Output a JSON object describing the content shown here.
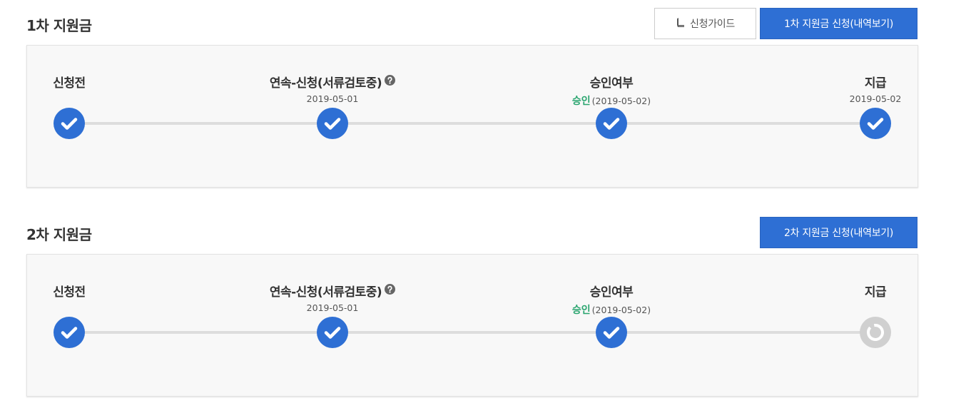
{
  "sections": [
    {
      "title": "1차 지원금",
      "guide_button": "신청가이드",
      "apply_button": "1차 지원금 신청(내역보기)",
      "steps": [
        {
          "label": "신청전",
          "date": "",
          "status": "done"
        },
        {
          "label": "연속-신청(서류검토중)",
          "date": "2019-05-01",
          "status": "done"
        },
        {
          "label": "승인여부",
          "approval": "승인",
          "date": "(2019-05-02)",
          "status": "done"
        },
        {
          "label": "지급",
          "date": "2019-05-02",
          "status": "done"
        }
      ]
    },
    {
      "title": "2차 지원금",
      "apply_button": "2차 지원금 신청(내역보기)",
      "steps": [
        {
          "label": "신청전",
          "date": "",
          "status": "done"
        },
        {
          "label": "연속-신청(서류검토중)",
          "date": "2019-05-01",
          "status": "done"
        },
        {
          "label": "승인여부",
          "approval": "승인",
          "date": "(2019-05-02)",
          "status": "done"
        },
        {
          "label": "지급",
          "date": "",
          "status": "pending"
        }
      ]
    }
  ],
  "icons": {
    "guide": "book-icon",
    "help": "question-circle-icon",
    "done": "check-circle-icon",
    "pending": "spinner-ring-icon"
  },
  "colors": {
    "primary": "#2e6fd4",
    "approved": "#2aa56f",
    "pending": "#d0d0d0",
    "track": "#dddddd"
  }
}
